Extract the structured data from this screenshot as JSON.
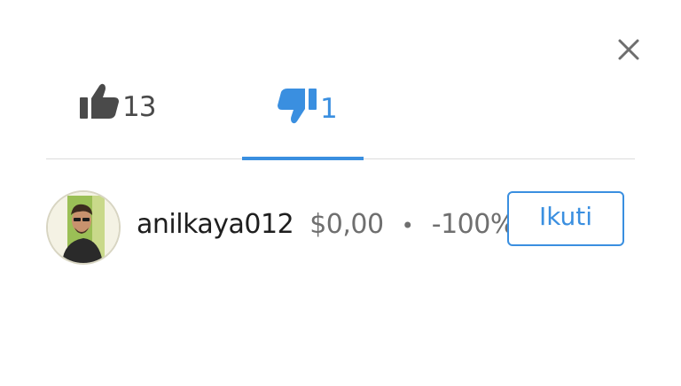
{
  "header": {
    "close_icon": "close-icon"
  },
  "tabs": [
    {
      "icon": "thumbs-up-icon",
      "count": "13",
      "active": false
    },
    {
      "icon": "thumbs-down-icon",
      "count": "1",
      "active": true
    }
  ],
  "colors": {
    "accent": "#3a8fe0",
    "inactive": "#4a4a4a",
    "muted_text": "#6f6f6f",
    "divider": "#dcdcdc"
  },
  "voter": {
    "username": "anilkaya012",
    "payout": "$0,00",
    "separator": "•",
    "change": "-100%",
    "follow_label": "Ikuti"
  }
}
